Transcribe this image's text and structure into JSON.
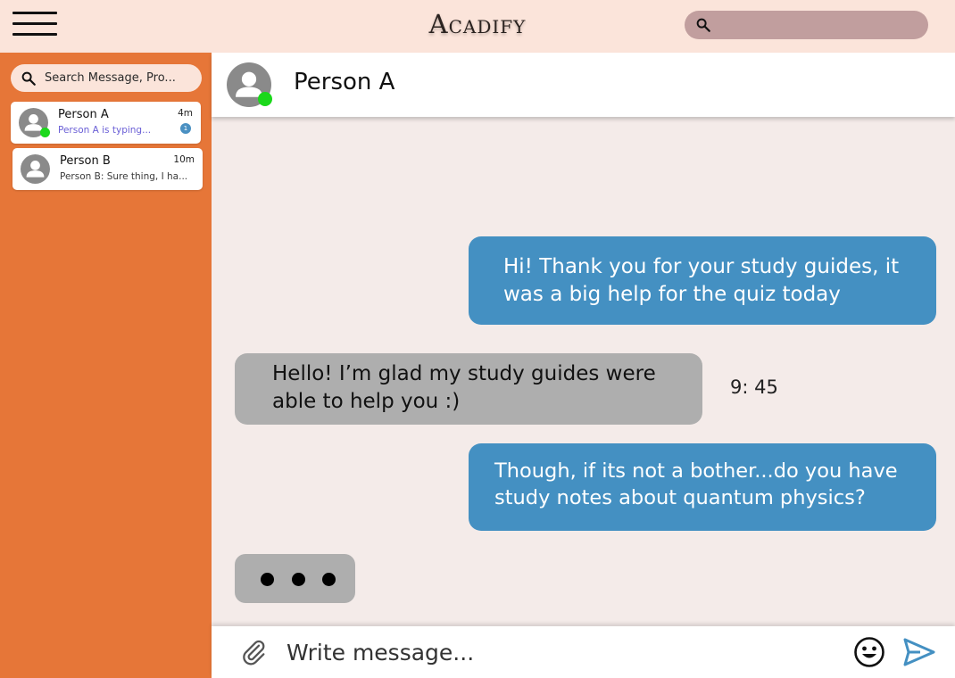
{
  "app": {
    "logo_text": "Acadify"
  },
  "colors": {
    "topbar": "#fbe4da",
    "sidebar": "#e67638",
    "sent_bubble": "#4490c2",
    "received_bubble": "#aeaeae",
    "online": "#1bd81b"
  },
  "icons": {
    "menu": "hamburger-menu-icon",
    "search": "search-icon",
    "avatar": "user-avatar-icon",
    "attach": "paperclip-icon",
    "emoji": "smiley-icon",
    "send": "send-icon"
  },
  "sidebar": {
    "search_placeholder": "Search Message, Pro...",
    "contacts": [
      {
        "name": "Person A",
        "preview": "Person A is typing...",
        "time": "4m",
        "unread": "1",
        "online": true
      },
      {
        "name": "Person B",
        "preview": "Person B: Sure thing, I ha...",
        "time": "10m",
        "unread": "",
        "online": false
      }
    ]
  },
  "chat": {
    "contact_name": "Person A",
    "messages": [
      {
        "from": "me",
        "text": "Hi! Thank you for your study guides, it was a big help for the quiz today"
      },
      {
        "from": "them",
        "text": "Hello! I’m glad my study guides were able to help you :)",
        "time": "9: 45"
      },
      {
        "from": "me",
        "text": "Though, if its not a bother...do you have study notes about quantum physics?"
      }
    ],
    "typing": true
  },
  "composer": {
    "placeholder": "Write message..."
  }
}
